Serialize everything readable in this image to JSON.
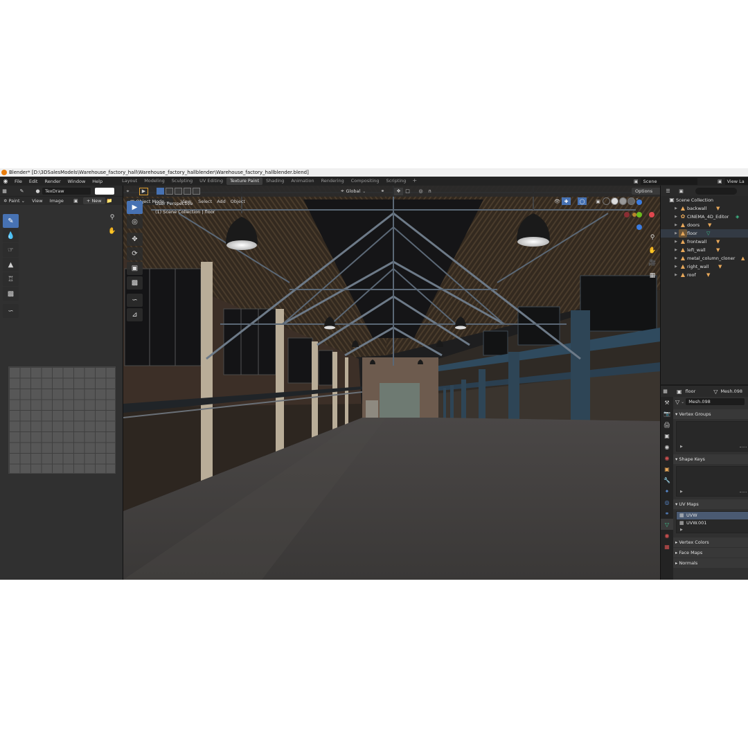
{
  "window": {
    "title": "Blender* [D:\\3DSalesModels\\Warehouse_factory_hall\\Warehouse_factory_hallblender\\Warehouse_factory_hallblender.blend]"
  },
  "menu": [
    "File",
    "Edit",
    "Render",
    "Window",
    "Help"
  ],
  "workspaces": [
    {
      "label": "Layout",
      "active": false
    },
    {
      "label": "Modeling",
      "active": false
    },
    {
      "label": "Sculpting",
      "active": false
    },
    {
      "label": "UV Editing",
      "active": false
    },
    {
      "label": "Texture Paint",
      "active": true
    },
    {
      "label": "Shading",
      "active": false
    },
    {
      "label": "Animation",
      "active": false
    },
    {
      "label": "Rendering",
      "active": false
    },
    {
      "label": "Compositing",
      "active": false
    },
    {
      "label": "Scripting",
      "active": false
    }
  ],
  "scene": {
    "label": "Scene"
  },
  "view_layer": {
    "label": "View La"
  },
  "image_editor": {
    "brush_name": "TexDraw",
    "mode": "Paint",
    "menu_view": "View",
    "menu_image": "Image",
    "new_button": "New"
  },
  "viewport": {
    "mode": "Object Mode",
    "menus": [
      "View",
      "Select",
      "Add",
      "Object"
    ],
    "transform_orientation": "Global",
    "options": "Options",
    "perspective_label": "User Perspective",
    "collection_label": "(1) Scene Collection | floor",
    "axes": {
      "x": "X",
      "y": "Y",
      "z": "Z"
    }
  },
  "outliner": {
    "root": "Scene Collection",
    "items": [
      {
        "name": "backwall"
      },
      {
        "name": "CINEMA_4D_Editor"
      },
      {
        "name": "doors"
      },
      {
        "name": "floor"
      },
      {
        "name": "frontwall"
      },
      {
        "name": "left_wall"
      },
      {
        "name": "metal_column_cloner"
      },
      {
        "name": "right_wall"
      },
      {
        "name": "roof"
      }
    ]
  },
  "properties": {
    "object_name": "floor",
    "mesh_name": "Mesh.098",
    "data_name": "Mesh.098",
    "panels": {
      "vertex_groups": "Vertex Groups",
      "shape_keys": "Shape Keys",
      "uv_maps": "UV Maps",
      "vertex_colors": "Vertex Colors",
      "face_maps": "Face Maps",
      "normals": "Normals"
    },
    "uv_maps": [
      {
        "name": "UVW",
        "selected": true
      },
      {
        "name": "UVW.001",
        "selected": false
      }
    ]
  },
  "colors": {
    "accent": "#4772b3",
    "x_axis": "#e0484f",
    "y_axis": "#6cbd1e",
    "z_axis": "#3b7ce0",
    "object_icon": "#e8a85a"
  }
}
